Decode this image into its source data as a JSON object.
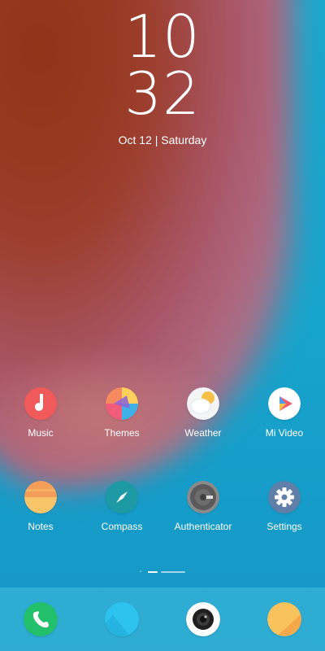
{
  "clock": {
    "hour": "10",
    "minute": "32"
  },
  "date": "Oct 12 | Saturday",
  "apps_row1": [
    {
      "label": "Music",
      "icon": "music-icon",
      "color": "#f05a5a"
    },
    {
      "label": "Themes",
      "icon": "themes-icon",
      "color": "#f7885a"
    },
    {
      "label": "Weather",
      "icon": "weather-icon",
      "color": "#f4f4f4"
    },
    {
      "label": "Mi Video",
      "icon": "video-icon",
      "color": "#ffffff"
    }
  ],
  "apps_row2": [
    {
      "label": "Notes",
      "icon": "notes-icon",
      "color": "#f7c46a"
    },
    {
      "label": "Compass",
      "icon": "compass-icon",
      "color": "#1f9aa3"
    },
    {
      "label": "Authenticator",
      "icon": "authenticator-icon",
      "color": "#5a5a5a"
    },
    {
      "label": "Settings",
      "icon": "settings-icon",
      "color": "#5f7fa8"
    }
  ],
  "page_indicator": {
    "pages": 3,
    "active_index": 1
  },
  "dock": [
    {
      "icon": "phone-icon",
      "color": "#22c06a"
    },
    {
      "icon": "messaging-icon",
      "color": "#2ec3ef"
    },
    {
      "icon": "camera-icon",
      "color": "#ffffff"
    },
    {
      "icon": "chat-icon",
      "color": "#f8c35c"
    }
  ]
}
